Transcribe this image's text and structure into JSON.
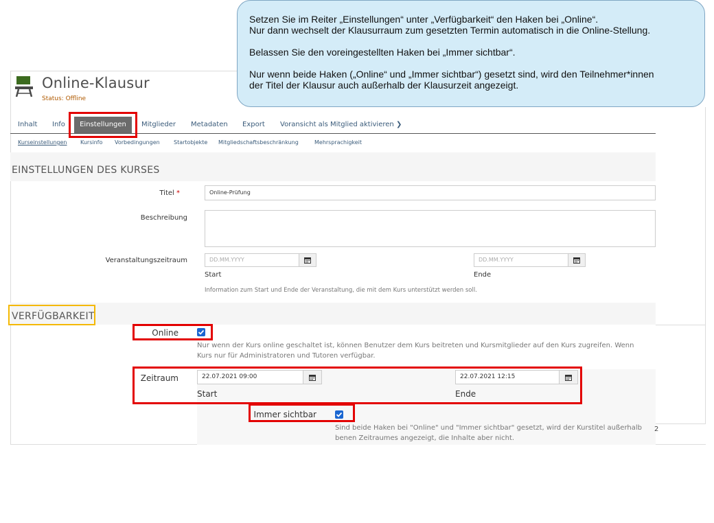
{
  "callout": {
    "line1": "Setzen Sie im Reiter „Einstellungen“ unter „Verfügbarkeit“ den Haken bei „Online“.",
    "line2": "Nur dann wechselt der Klausurraum zum gesetzten Termin automatisch in die Online-Stellung.",
    "line3": "Belassen Sie den voreingestellten Haken bei „Immer sichtbar“.",
    "line4": "Nur wenn beide Haken („Online“ und „Immer sichtbar“) gesetzt sind, wird den Teilnehmer*innen",
    "line5": "der Titel der Klausur auch außerhalb der Klausurzeit angezeigt."
  },
  "header": {
    "title": "Online-Klausur",
    "status": "Status: Offline",
    "icon": "exam-desk-icon"
  },
  "tabs": {
    "inhalt": "Inhalt",
    "info": "Info",
    "einstellungen": "Einstellungen",
    "mitglieder": "Mitglieder",
    "metadaten": "Metadaten",
    "export": "Export",
    "voransicht": "Voransicht als Mitglied aktivieren",
    "voransicht_arrow": "❯"
  },
  "subtabs": {
    "kurseinstellungen": "Kurseinstellungen",
    "kursinfo": "Kursinfo",
    "vorbedingungen": "Vorbedingungen",
    "startobjekte": "Startobjekte",
    "mitgliedschaft": "Mitgliedschaftsbeschränkung",
    "mehrsprachigkeit": "Mehrsprachigkeit"
  },
  "settings": {
    "section_title": "EINSTELLUNGEN DES KURSES",
    "titel_label": "Titel",
    "required_mark": "*",
    "titel_value": "Online-Prüfung",
    "beschreibung_label": "Beschreibung",
    "zeitraum_label": "Veranstaltungszeitraum",
    "date_placeholder": "DD.MM.YYYY",
    "start_label": "Start",
    "ende_label": "Ende",
    "zeitraum_help": "Information zum Start und Ende der Veranstaltung, die mit dem Kurs unterstützt werden soll."
  },
  "availability": {
    "section_title": "VERFÜGBARKEIT",
    "online_label": "Online",
    "online_checked": true,
    "online_help_1": "Nur wenn der Kurs online geschaltet ist, können Benutzer dem Kurs beitreten und Kursmitglieder auf den Kurs zugreifen. Wenn",
    "online_help_2": "Kurs nur für Administratoren und Tutoren verfügbar.",
    "zeitraum_label": "Zeitraum",
    "start_value": "22.07.2021 09:00",
    "end_value": "22.07.2021 12:15",
    "start_label": "Start",
    "ende_label": "Ende",
    "visible_label": "Immer sichtbar",
    "visible_checked": true,
    "visible_help_1": "Sind beide Haken bei \"Online\" und \"Immer sichtbar\" gesetzt, wird der Kurstitel außerhalb",
    "visible_help_2": "benen Zeitraumes angezeigt, die Inhalte aber nicht.",
    "page_number": "2"
  },
  "colors": {
    "highlight_red": "#e30000",
    "highlight_yellow": "#f4b800",
    "callout_bg": "#d4ecf8",
    "checkbox_blue": "#1a66d1"
  }
}
